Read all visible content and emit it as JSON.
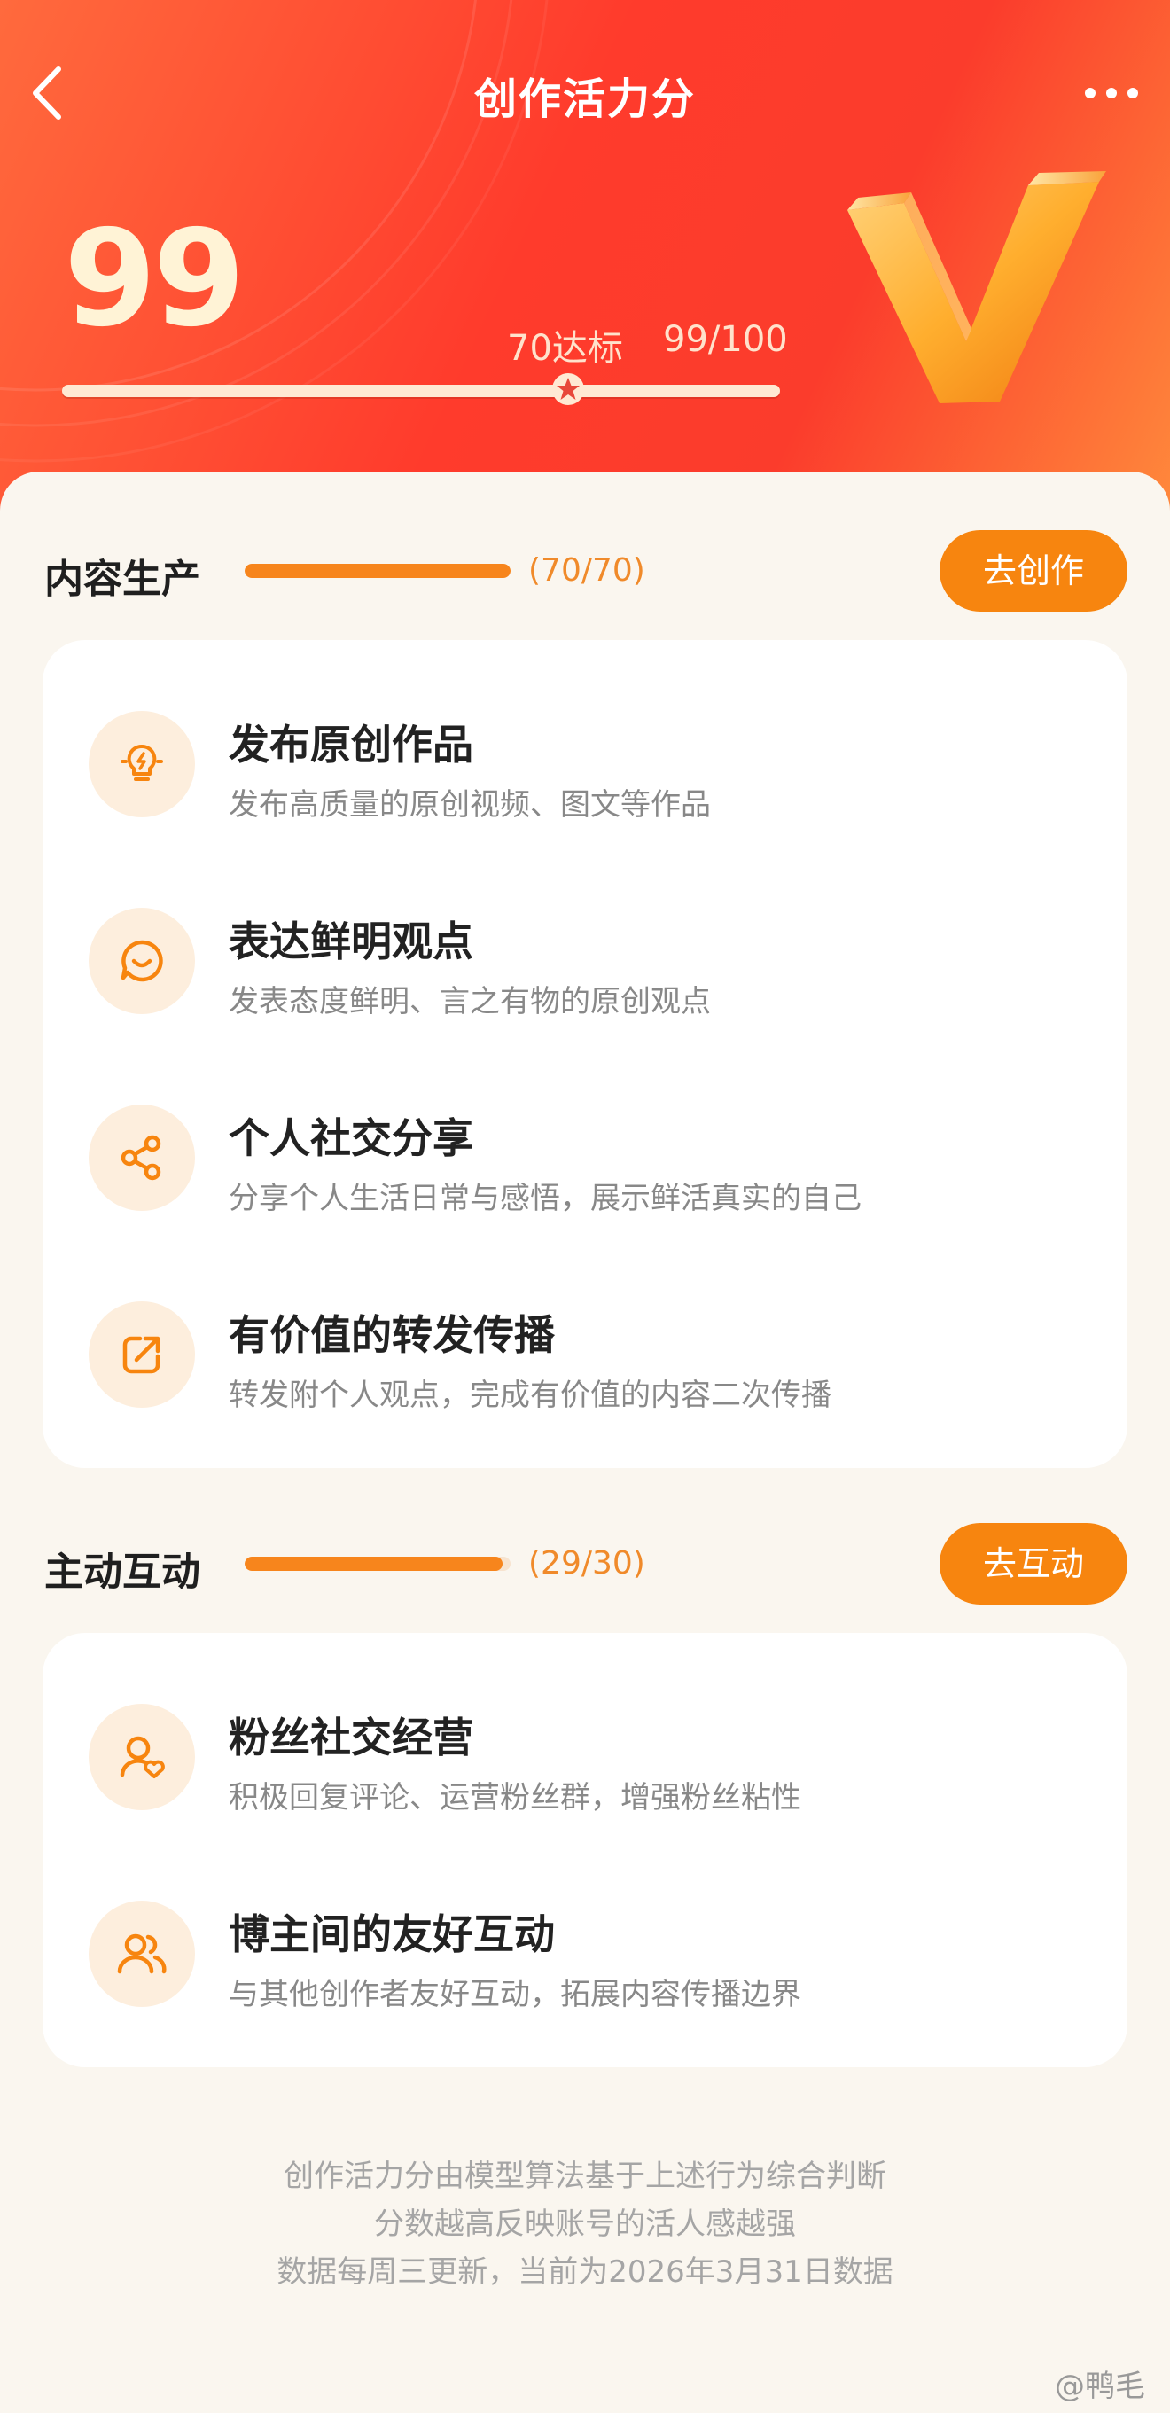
{
  "header": {
    "title": "创作活力分",
    "score": "99",
    "target_label": "70达标",
    "score_ratio": "99/100",
    "progress": 0.99,
    "target_mark": 0.7
  },
  "sections": [
    {
      "title": "内容生产",
      "count": "(70/70)",
      "progress": 1.0,
      "button": "去创作",
      "items": [
        {
          "icon": "lightbulb-icon",
          "title": "发布原创作品",
          "desc": "发布高质量的原创视频、图文等作品"
        },
        {
          "icon": "smile-chat-icon",
          "title": "表达鲜明观点",
          "desc": "发表态度鲜明、言之有物的原创观点"
        },
        {
          "icon": "share-icon",
          "title": "个人社交分享",
          "desc": "分享个人生活日常与感悟，展示鲜活真实的自己"
        },
        {
          "icon": "forward-icon",
          "title": "有价值的转发传播",
          "desc": "转发附个人观点，完成有价值的内容二次传播"
        }
      ]
    },
    {
      "title": "主动互动",
      "count": "(29/30)",
      "progress": 0.967,
      "button": "去互动",
      "items": [
        {
          "icon": "user-heart-icon",
          "title": "粉丝社交经营",
          "desc": "积极回复评论、运营粉丝群，增强粉丝粘性"
        },
        {
          "icon": "users-icon",
          "title": "博主间的友好互动",
          "desc": "与其他创作者友好互动，拓展内容传播边界"
        }
      ]
    }
  ],
  "footer": {
    "line1": "创作活力分由模型算法基于上述行为综合判断",
    "line2": "分数越高反映账号的活人感越强",
    "line3": "数据每周三更新，当前为2026年3月31日数据"
  },
  "watermark": "@鸭毛",
  "colors": {
    "accent": "#f7850f",
    "hero_red": "#ff3b2c",
    "icon_bg": "#fdeedd"
  }
}
